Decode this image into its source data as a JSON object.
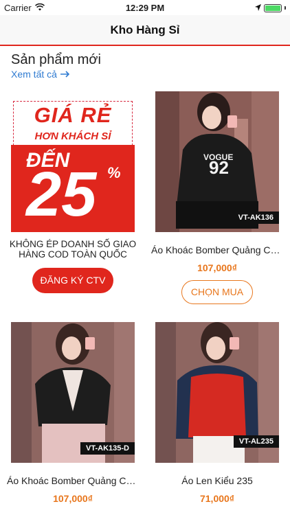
{
  "status_bar": {
    "carrier": "Carrier",
    "time": "12:29 PM"
  },
  "nav": {
    "title": "Kho Hàng Sỉ"
  },
  "section": {
    "title": "Sản phẩm mới",
    "see_all": "Xem tất cả"
  },
  "promo": {
    "line1": "GIÁ RẺ",
    "line2": "HƠN KHÁCH SỈ",
    "den": "ĐẾN",
    "percent_value": "25",
    "percent_sign": "%",
    "description": "KHÔNG ÉP DOANH SỐ GIAO HÀNG COD TOÀN QUỐC",
    "button": "ĐĂNG KÝ CTV"
  },
  "products": [
    {
      "code": "VT-AK136",
      "name": "Áo Khoác Bomber Quảng Châu",
      "price": "107,000₫",
      "button": "CHỌN MUA"
    },
    {
      "code": "VT-AK135-D",
      "name": "Áo Khoác Bomber Quảng Châu",
      "price": "107,000₫"
    },
    {
      "code": "VT-AL235",
      "name": "Áo Len Kiểu 235",
      "price": "71,000₫"
    }
  ],
  "colors": {
    "accent_red": "#e0261d",
    "price_orange": "#e8761c",
    "link_blue": "#2f7bd1"
  }
}
